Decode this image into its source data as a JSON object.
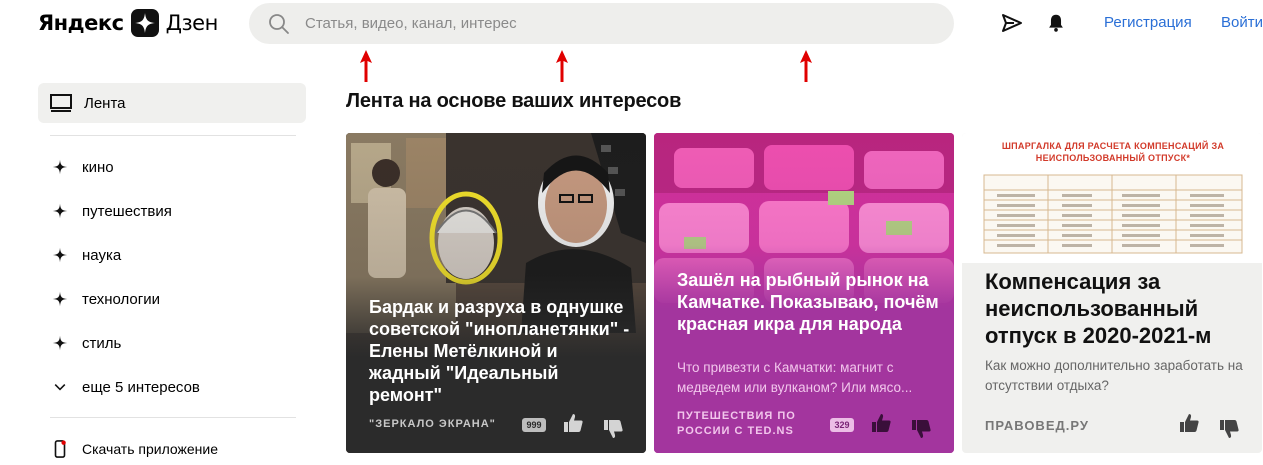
{
  "header": {
    "logo_text": "Яндекс",
    "logo_text2": "Дзен",
    "search_placeholder": "Статья, видео, канал, интерес",
    "register_label": "Регистрация",
    "login_label": "Войти"
  },
  "sidebar": {
    "feed_label": "Лента",
    "items": [
      {
        "label": "кино"
      },
      {
        "label": "путешествия"
      },
      {
        "label": "наука"
      },
      {
        "label": "технологии"
      },
      {
        "label": "стиль"
      }
    ],
    "more_label": "еще 5 интересов",
    "download_label": "Скачать приложение"
  },
  "feed": {
    "title": "Лента на основе ваших интересов",
    "cards": [
      {
        "title": "Бардак и разруха в однушке советской \"инопланетянки\" - Елены Метёлкиной и жадный \"Идеальный ремонт\"",
        "source": "\"ЗЕРКАЛО ЭКРАНА\"",
        "count": "999"
      },
      {
        "title": "Зашёл на рыбный рынок на Камчатке. Показываю, почём красная икра для народа",
        "description": "Что привезти с Камчатки: магнит с медведем или вулканом? Или мясо...",
        "source": "ПУТЕШЕСТВИЯ ПО РОССИИ С TED.NS",
        "count": "329"
      },
      {
        "image_title": "ШПАРГАЛКА ДЛЯ РАСЧЕТА КОМПЕНСАЦИЙ ЗА НЕИСПОЛЬЗОВАННЫЙ ОТПУСК*",
        "title": "Компенсация за неиспользованный отпуск в 2020-2021-м",
        "description": "Как можно дополнительно заработать на отсутствии отдыха?",
        "source": "ПРАВОВЕД.РУ"
      }
    ]
  },
  "colors": {
    "accent_link": "#2a6fd6",
    "card1_bg": "#2b2b2b",
    "card2_bg": "#a3359e",
    "card3_bg": "#f0f0ee",
    "annotation_arrow": "#e00000"
  }
}
